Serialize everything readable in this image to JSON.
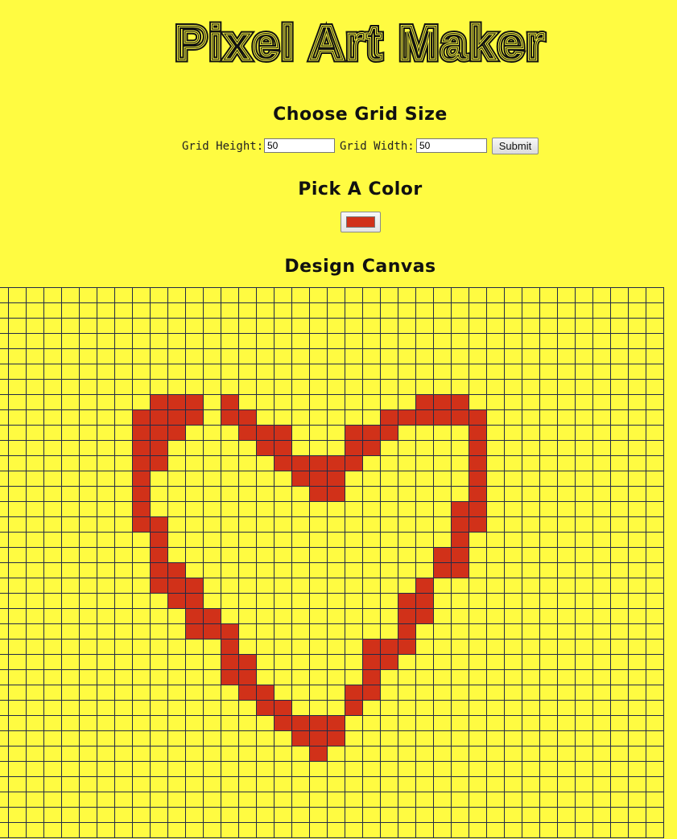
{
  "header": {
    "title": "Pixel Art Maker"
  },
  "grid_size": {
    "title": "Choose Grid Size",
    "height_label": "Grid Height:",
    "height_value": "50",
    "width_label": "Grid Width:",
    "width_value": "50",
    "submit_label": "Submit"
  },
  "color": {
    "title": "Pick A Color",
    "value": "#d13119"
  },
  "canvas": {
    "title": "Design Canvas",
    "rows": 50,
    "cols": 50,
    "visible_rows": 36,
    "visible_cols": 38,
    "background": "#fffb41",
    "line_color": "#232a47",
    "painted_color": "#d13119",
    "painted_cells": [
      [
        7,
        9
      ],
      [
        7,
        10
      ],
      [
        7,
        11
      ],
      [
        7,
        13
      ],
      [
        7,
        24
      ],
      [
        7,
        25
      ],
      [
        7,
        26
      ],
      [
        8,
        8
      ],
      [
        8,
        9
      ],
      [
        8,
        10
      ],
      [
        8,
        11
      ],
      [
        8,
        13
      ],
      [
        8,
        14
      ],
      [
        8,
        22
      ],
      [
        8,
        23
      ],
      [
        8,
        24
      ],
      [
        8,
        25
      ],
      [
        8,
        26
      ],
      [
        8,
        27
      ],
      [
        9,
        8
      ],
      [
        9,
        9
      ],
      [
        9,
        10
      ],
      [
        9,
        14
      ],
      [
        9,
        15
      ],
      [
        9,
        16
      ],
      [
        9,
        20
      ],
      [
        9,
        21
      ],
      [
        9,
        22
      ],
      [
        9,
        27
      ],
      [
        10,
        8
      ],
      [
        10,
        9
      ],
      [
        10,
        15
      ],
      [
        10,
        16
      ],
      [
        10,
        20
      ],
      [
        10,
        21
      ],
      [
        10,
        27
      ],
      [
        11,
        8
      ],
      [
        11,
        9
      ],
      [
        11,
        16
      ],
      [
        11,
        17
      ],
      [
        11,
        18
      ],
      [
        11,
        19
      ],
      [
        11,
        20
      ],
      [
        11,
        27
      ],
      [
        12,
        8
      ],
      [
        12,
        17
      ],
      [
        12,
        18
      ],
      [
        12,
        19
      ],
      [
        12,
        27
      ],
      [
        13,
        8
      ],
      [
        13,
        18
      ],
      [
        13,
        19
      ],
      [
        13,
        27
      ],
      [
        14,
        8
      ],
      [
        14,
        26
      ],
      [
        14,
        27
      ],
      [
        15,
        8
      ],
      [
        15,
        9
      ],
      [
        15,
        26
      ],
      [
        15,
        27
      ],
      [
        16,
        9
      ],
      [
        16,
        26
      ],
      [
        17,
        9
      ],
      [
        17,
        25
      ],
      [
        17,
        26
      ],
      [
        18,
        9
      ],
      [
        18,
        10
      ],
      [
        18,
        25
      ],
      [
        18,
        26
      ],
      [
        19,
        9
      ],
      [
        19,
        10
      ],
      [
        19,
        11
      ],
      [
        19,
        24
      ],
      [
        20,
        10
      ],
      [
        20,
        11
      ],
      [
        20,
        23
      ],
      [
        20,
        24
      ],
      [
        21,
        11
      ],
      [
        21,
        12
      ],
      [
        21,
        23
      ],
      [
        21,
        24
      ],
      [
        22,
        11
      ],
      [
        22,
        12
      ],
      [
        22,
        13
      ],
      [
        22,
        23
      ],
      [
        23,
        13
      ],
      [
        23,
        21
      ],
      [
        23,
        22
      ],
      [
        23,
        23
      ],
      [
        24,
        13
      ],
      [
        24,
        14
      ],
      [
        24,
        21
      ],
      [
        24,
        22
      ],
      [
        25,
        13
      ],
      [
        25,
        14
      ],
      [
        25,
        21
      ],
      [
        26,
        14
      ],
      [
        26,
        15
      ],
      [
        26,
        20
      ],
      [
        26,
        21
      ],
      [
        27,
        15
      ],
      [
        27,
        16
      ],
      [
        27,
        20
      ],
      [
        28,
        16
      ],
      [
        28,
        17
      ],
      [
        28,
        18
      ],
      [
        28,
        19
      ],
      [
        29,
        17
      ],
      [
        29,
        18
      ],
      [
        29,
        19
      ],
      [
        30,
        18
      ]
    ]
  }
}
